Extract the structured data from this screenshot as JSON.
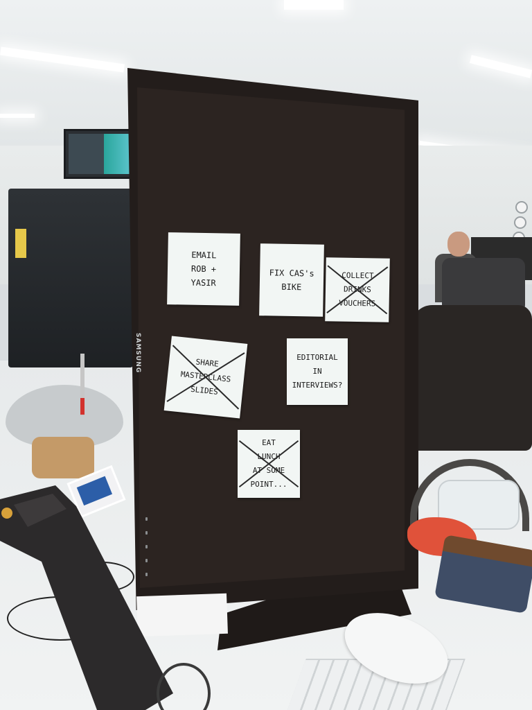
{
  "scene": {
    "monitor_brand": "SAMSUNG",
    "colors": {
      "monitor": "#231d1b",
      "sticky_note": "#f2f6f4",
      "desk": "#ecefef",
      "wallet_leather": "#6f4a2e",
      "wallet_denim": "#3f4d66",
      "cloth": "#e0523a"
    }
  },
  "notes": [
    {
      "id": "email",
      "text": "EMAIL\nROB +\nYASIR",
      "crossed_out": false
    },
    {
      "id": "fix-bike",
      "text": "FIX CAS's\nBIKE",
      "crossed_out": false
    },
    {
      "id": "collect-vouchers",
      "text": "COLLECT\nDRINKS\nVOUCHERS",
      "crossed_out": true
    },
    {
      "id": "share-slides",
      "text": "SHARE\nMASTERCLASS\nSLIDES",
      "crossed_out": true
    },
    {
      "id": "editorial",
      "text": "EDITORIAL\nIN\nINTERVIEWS?",
      "crossed_out": false
    },
    {
      "id": "eat-lunch",
      "text": "EAT\nLUNCH\nAT SOME POINT...",
      "crossed_out": true
    }
  ]
}
